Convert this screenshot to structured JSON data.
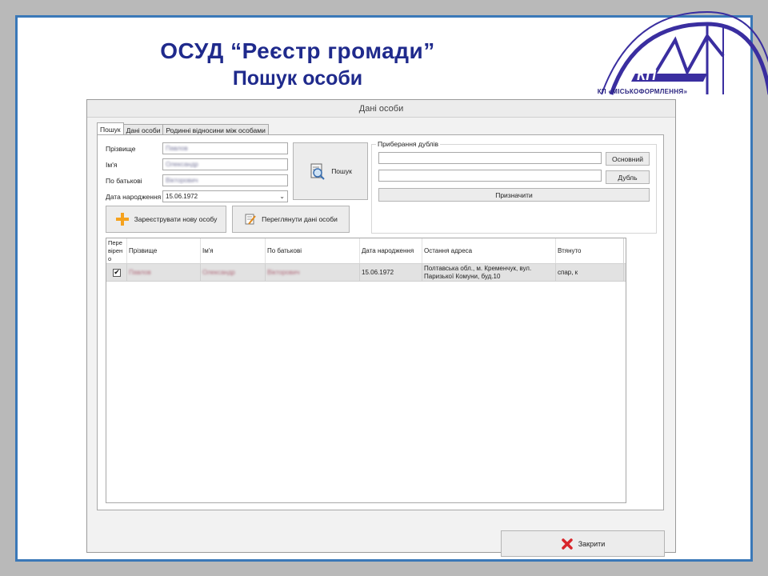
{
  "slide": {
    "title": "ОСУД “Реєстр громади”",
    "subtitle": "Пошук особи",
    "logo_text": "КП",
    "logo_caption": "КП «МІСЬКОФОРМЛЕННЯ»"
  },
  "window": {
    "title": "Дані особи",
    "tabs": [
      {
        "label": "Пошук",
        "active": true
      },
      {
        "label": "Дані особи",
        "active": false
      },
      {
        "label": "Родинні відносини між особами",
        "active": false
      }
    ]
  },
  "search": {
    "surname_label": "Прізвище",
    "surname_value": "Павлов",
    "name_label": "Ім'я",
    "name_value": "Олександр",
    "patronymic_label": "По батькові",
    "patronymic_value": "Вікторович",
    "birthdate_label": "Дата народження",
    "birthdate_value": "15.06.1972",
    "search_button": "Пошук",
    "register_button": "Зареєструвати нову особу",
    "view_button": "Переглянути дані особи"
  },
  "duplicates": {
    "legend": "Приберання дублів",
    "main_value": "",
    "main_button": "Основний",
    "dup_value": "",
    "dup_button": "Дубль",
    "assign_button": "Призначити"
  },
  "results": {
    "columns": [
      "Пере\nвірен\nо",
      "Прізвище",
      "Ім'я",
      "По батькові",
      "Дата народження",
      "Остання адреса",
      "Втянуто"
    ],
    "rows": [
      {
        "checked": true,
        "surname": "Павлов",
        "name": "Олександр",
        "patronymic": "Вікторович",
        "birthdate": "15.06.1972",
        "address": "Полтавська обл., м. Кременчук, вул. Паризької Комуни, буд.10",
        "pulled": "спар, к"
      }
    ]
  },
  "footer": {
    "close_button": "Закрити"
  },
  "colors": {
    "accent_blue": "#1f2a8c",
    "frame_blue": "#3a78b8",
    "plus_orange": "#f5a21e",
    "close_red": "#d8262b"
  }
}
